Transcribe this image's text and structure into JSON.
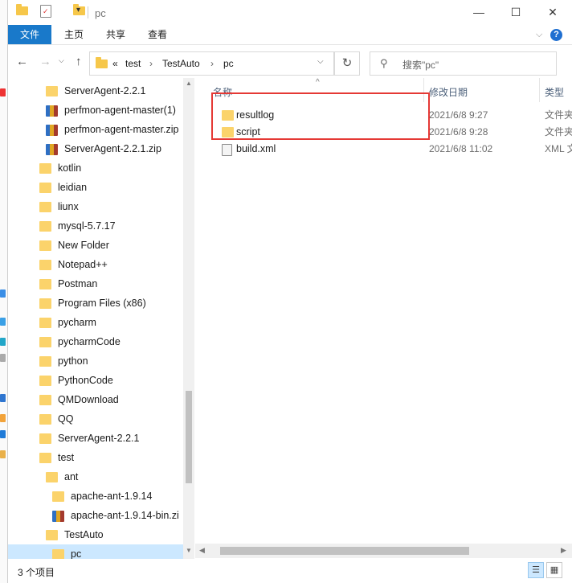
{
  "window": {
    "title": "pc"
  },
  "window_buttons": {
    "minimize": "—",
    "maximize": "☐",
    "close": "✕"
  },
  "ribbon": {
    "tabs": [
      "文件",
      "主页",
      "共享",
      "查看"
    ],
    "help": "?"
  },
  "nav_buttons": {
    "back": "←",
    "forward": "→",
    "up": "↑"
  },
  "address": {
    "prefix": "«",
    "crumbs": [
      "test",
      "TestAuto",
      "pc"
    ],
    "separator": "›"
  },
  "search": {
    "placeholder": "搜索\"pc\""
  },
  "tree": [
    {
      "label": "ServerAgent-2.2.1",
      "type": "folder",
      "level": 2
    },
    {
      "label": "perfmon-agent-master(1)",
      "type": "zip",
      "level": 2
    },
    {
      "label": "perfmon-agent-master.zip",
      "type": "zip",
      "level": 2
    },
    {
      "label": "ServerAgent-2.2.1.zip",
      "type": "zip",
      "level": 2
    },
    {
      "label": "kotlin",
      "type": "folder",
      "level": 1
    },
    {
      "label": "leidian",
      "type": "folder",
      "level": 1
    },
    {
      "label": "liunx",
      "type": "folder",
      "level": 1
    },
    {
      "label": "mysql-5.7.17",
      "type": "folder",
      "level": 1
    },
    {
      "label": "New Folder",
      "type": "folder",
      "level": 1
    },
    {
      "label": "Notepad++",
      "type": "folder",
      "level": 1
    },
    {
      "label": "Postman",
      "type": "folder",
      "level": 1
    },
    {
      "label": "Program Files (x86)",
      "type": "folder",
      "level": 1
    },
    {
      "label": "pycharm",
      "type": "folder",
      "level": 1
    },
    {
      "label": "pycharmCode",
      "type": "folder",
      "level": 1
    },
    {
      "label": "python",
      "type": "folder",
      "level": 1
    },
    {
      "label": "PythonCode",
      "type": "folder",
      "level": 1
    },
    {
      "label": "QMDownload",
      "type": "folder",
      "level": 1
    },
    {
      "label": "QQ",
      "type": "folder",
      "level": 1
    },
    {
      "label": "ServerAgent-2.2.1",
      "type": "folder",
      "level": 1
    },
    {
      "label": "test",
      "type": "folder",
      "level": 1
    },
    {
      "label": "ant",
      "type": "folder",
      "level": 2
    },
    {
      "label": "apache-ant-1.9.14",
      "type": "folder",
      "level": 3
    },
    {
      "label": "apache-ant-1.9.14-bin.zi",
      "type": "zip",
      "level": 3
    },
    {
      "label": "TestAuto",
      "type": "folder",
      "level": 2
    },
    {
      "label": "pc",
      "type": "folder",
      "level": 3,
      "selected": true
    }
  ],
  "columns": {
    "name": "名称",
    "date": "修改日期",
    "type": "类型"
  },
  "files": [
    {
      "name": "resultlog",
      "date": "2021/6/8 9:27",
      "type": "文件夹",
      "icon": "folder-icon"
    },
    {
      "name": "script",
      "date": "2021/6/8 9:28",
      "type": "文件夹",
      "icon": "folder-icon"
    },
    {
      "name": "build.xml",
      "date": "2021/6/8 11:02",
      "type": "XML 文",
      "icon": "xml-file-icon"
    }
  ],
  "status": {
    "count_text": "3 个项目"
  },
  "colors": {
    "accent": "#1979ca",
    "selection": "#cce8ff",
    "highlight": "#e53935",
    "folder": "#fbd36b"
  }
}
